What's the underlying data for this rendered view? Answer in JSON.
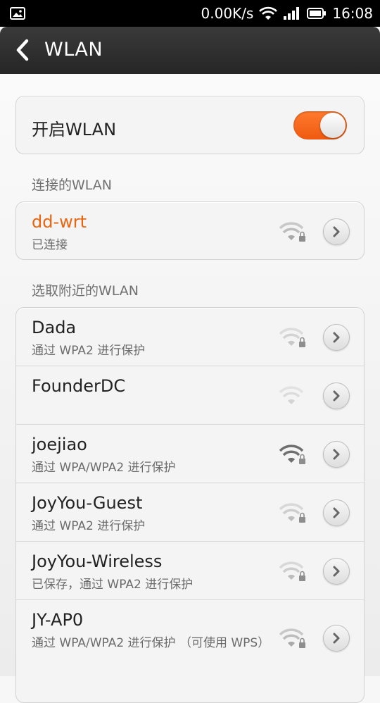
{
  "status_bar": {
    "speed": "0.00K/s",
    "time": "16:08",
    "icons": [
      "image-icon",
      "wifi-icon",
      "signal-icon",
      "battery-icon"
    ]
  },
  "header": {
    "title": "WLAN"
  },
  "wlan_toggle": {
    "label": "开启WLAN",
    "on": true,
    "accent": "#f26b1d"
  },
  "connected_section": {
    "label": "连接的WLAN",
    "network": {
      "name": "dd-wrt",
      "status": "已连接",
      "name_color": "#e8650f"
    }
  },
  "nearby_section": {
    "label": "选取附近的WLAN",
    "networks": [
      {
        "name": "Dada",
        "status": "通过 WPA2 进行保护"
      },
      {
        "name": "FounderDC",
        "status": ""
      },
      {
        "name": "joejiao",
        "status": "通过 WPA/WPA2 进行保护"
      },
      {
        "name": "JoyYou-Guest",
        "status": "通过 WPA2 进行保护"
      },
      {
        "name": "JoyYou-Wireless",
        "status": "已保存，通过 WPA2 进行保护"
      },
      {
        "name": "JY-AP0",
        "status": "通过 WPA/WPA2 进行保护 （可使用 WPS）"
      }
    ]
  }
}
